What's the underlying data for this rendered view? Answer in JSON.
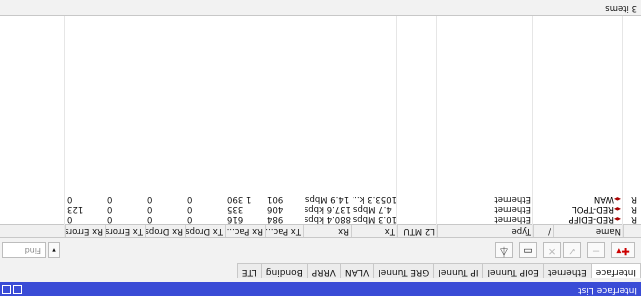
{
  "window": {
    "title": "Interface List"
  },
  "tabs": [
    "Interface",
    "Ethernet",
    "EoIP Tunnel",
    "IP Tunnel",
    "GRE Tunnel",
    "VLAN",
    "VRRP",
    "Bonding",
    "LTE"
  ],
  "toolbar": {
    "add_icon": "plus-icon",
    "find_placeholder": "Find"
  },
  "table": {
    "columns": [
      "",
      "Name",
      "/",
      "Type",
      "L2 MTU",
      "Tx",
      "Rx",
      "Tx Pac...",
      "Rx Pac...",
      "Tx Drops",
      "Rx Drops",
      "Tx Errors",
      "Rx Errors"
    ],
    "rows": [
      {
        "flag": "R",
        "name": "RED-EDIFP",
        "type": "Ethernet",
        "l2mtu": "",
        "tx": "10.3 Mbps",
        "rx": "880.4 kbps",
        "tx_pac": "984",
        "rx_pac": "616",
        "tx_drops": "0",
        "rx_drops": "0",
        "tx_errors": "0",
        "rx_errors": "0"
      },
      {
        "flag": "R",
        "name": "RED-TPOL",
        "type": "Ethernet",
        "l2mtu": "",
        "tx": "4.7 Mbps",
        "rx": "137.6 kbps",
        "tx_pac": "406",
        "rx_pac": "335",
        "tx_drops": "0",
        "rx_drops": "0",
        "tx_errors": "0",
        "rx_errors": "123"
      },
      {
        "flag": "R",
        "name": "WAN",
        "type": "Ethernet",
        "l2mtu": "",
        "tx": "1053.3 k...",
        "rx": "14.9 Mbps",
        "tx_pac": "901",
        "rx_pac": "1 390",
        "tx_drops": "0",
        "rx_drops": "0",
        "tx_errors": "0",
        "rx_errors": "0"
      }
    ]
  },
  "status": {
    "items": "3 items"
  }
}
